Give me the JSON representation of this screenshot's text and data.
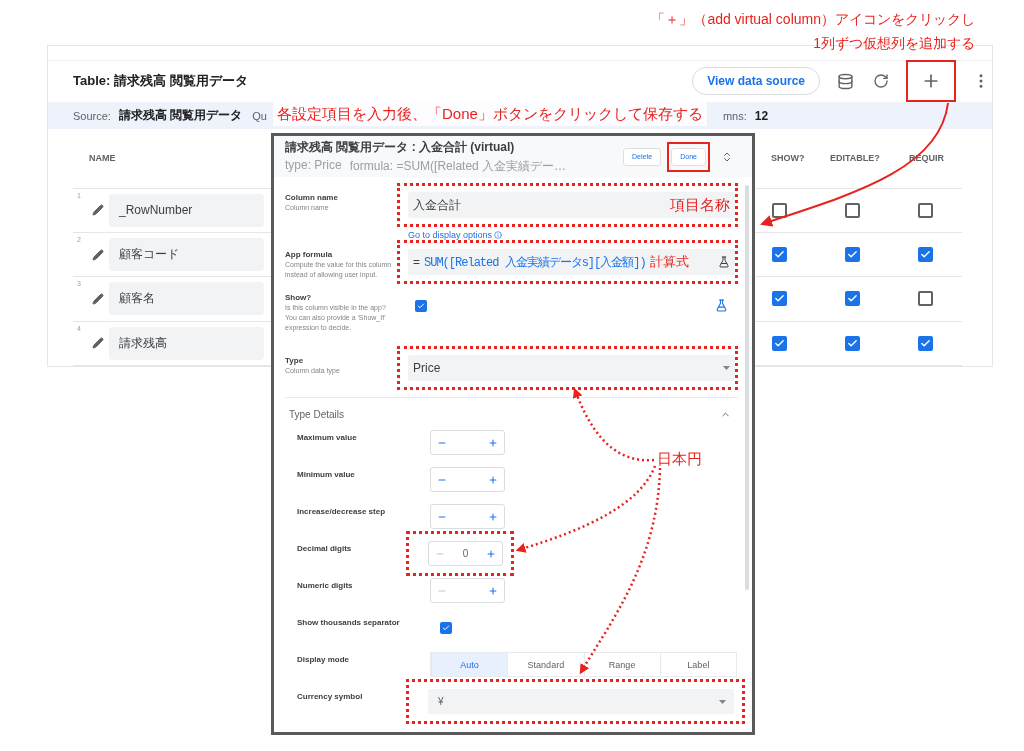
{
  "annotations": {
    "add_column_note": [
      "「＋」（add virtual column）アイコンをクリックし",
      "1列ずつ仮想列を追加する"
    ],
    "save_note": "各設定項目を入力後、「Done」ボタンをクリックして保存する",
    "column_name_note": "項目名称",
    "formula_note": "計算式",
    "currency_note": "日本円"
  },
  "table": {
    "title": "Table: 請求残高 閲覧用データ",
    "view_button": "View data source",
    "source_label": "Source:",
    "source_value": "請求残高 閲覧用データ",
    "hidden_fragment": "Qu",
    "columns_label": "mns:",
    "columns_value": "12",
    "columns": [
      "NAME",
      "SHOW?",
      "EDITABLE?",
      "REQUIR"
    ],
    "rows": [
      {
        "number": "1",
        "name": "_RowNumber",
        "show": false,
        "editable": false,
        "required": false
      },
      {
        "number": "2",
        "name": "顧客コード",
        "show": true,
        "editable": true,
        "required": true
      },
      {
        "number": "3",
        "name": "顧客名",
        "show": true,
        "editable": true,
        "required": false
      },
      {
        "number": "4",
        "name": "請求残高",
        "show": true,
        "editable": true,
        "required": true
      }
    ]
  },
  "dialog": {
    "title": "請求残高 閲覧用データ : 入金合計 (virtual)",
    "type_summary": "type: Price",
    "formula_summary": "formula: =SUM([Related 入金実績デー…",
    "delete_button": "Delete",
    "done_button": "Done",
    "column_name": {
      "label": "Column name",
      "hint": "Column name",
      "value": "入金合計",
      "link": "Go to display options"
    },
    "app_formula": {
      "label": "App formula",
      "hint": "Compute the value for this column instead of allowing user input.",
      "equals": "=",
      "value": "SUM([Related 入金実績データs][入金額])"
    },
    "show": {
      "label": "Show?",
      "hint": "Is this column visible in the app? You can also provide a 'Show_If' expression to decide.",
      "checked": true
    },
    "type": {
      "label": "Type",
      "hint": "Column data type",
      "value": "Price"
    },
    "type_details": {
      "title": "Type Details",
      "expanded": true,
      "steppers": [
        {
          "label": "Maximum value",
          "minus_disabled": false
        },
        {
          "label": "Minimum value",
          "minus_disabled": false
        },
        {
          "label": "Increase/decrease step",
          "minus_disabled": false
        },
        {
          "label": "Decimal digits",
          "value": "0",
          "minus_disabled": true,
          "highlighted": true
        },
        {
          "label": "Numeric digits",
          "minus_disabled": true
        }
      ],
      "thousands": {
        "label": "Show thousands separator",
        "checked": true
      },
      "display_mode": {
        "label": "Display mode",
        "options": [
          {
            "label": "Auto",
            "selected": true
          },
          {
            "label": "Standard",
            "selected": false
          },
          {
            "label": "Range",
            "selected": false
          },
          {
            "label": "Label",
            "selected": false
          }
        ]
      },
      "currency": {
        "label": "Currency symbol",
        "value": "¥"
      }
    }
  }
}
